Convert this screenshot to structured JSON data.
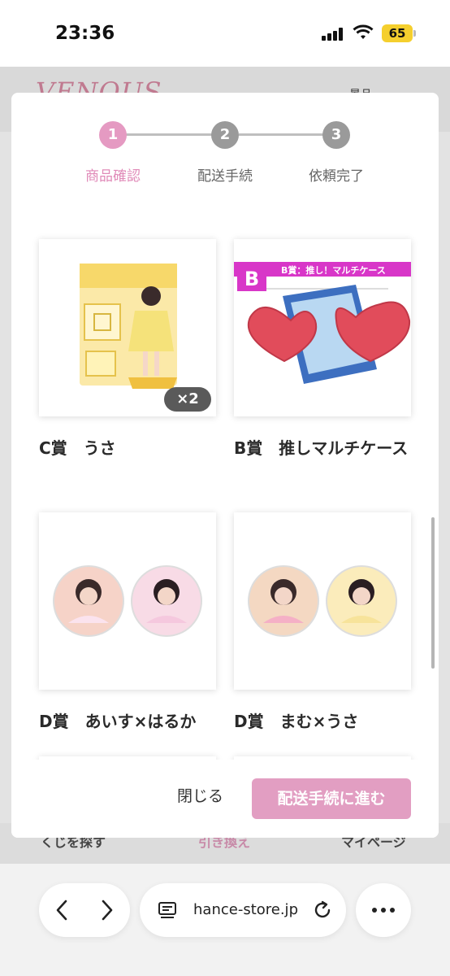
{
  "status_bar": {
    "time": "23:36",
    "battery": "65"
  },
  "background": {
    "logo": "VENOUS",
    "header_right": "景品",
    "tabs": [
      "くじを探す",
      "引き換え",
      "マイページ"
    ]
  },
  "modal": {
    "steps": [
      {
        "number": "1",
        "label": "商品確認",
        "active": true
      },
      {
        "number": "2",
        "label": "配送手続",
        "active": false
      },
      {
        "number": "3",
        "label": "依頼完了",
        "active": false
      }
    ],
    "items": [
      {
        "title": "C賞　うさ",
        "quantity": "×2"
      },
      {
        "title": "B賞　推しマルチケース",
        "b_label": "B",
        "b_banner": "B賞：推し！マルチケース"
      },
      {
        "title": "D賞　あいす×はるか"
      },
      {
        "title": "D賞　まむ×うさ"
      }
    ],
    "close_label": "閉じる",
    "proceed_label": "配送手続に進む"
  },
  "browser": {
    "url": "hance-store.jp"
  },
  "colors": {
    "accent_pink": "#e29ec2",
    "step_inactive": "#9a9a9a"
  }
}
